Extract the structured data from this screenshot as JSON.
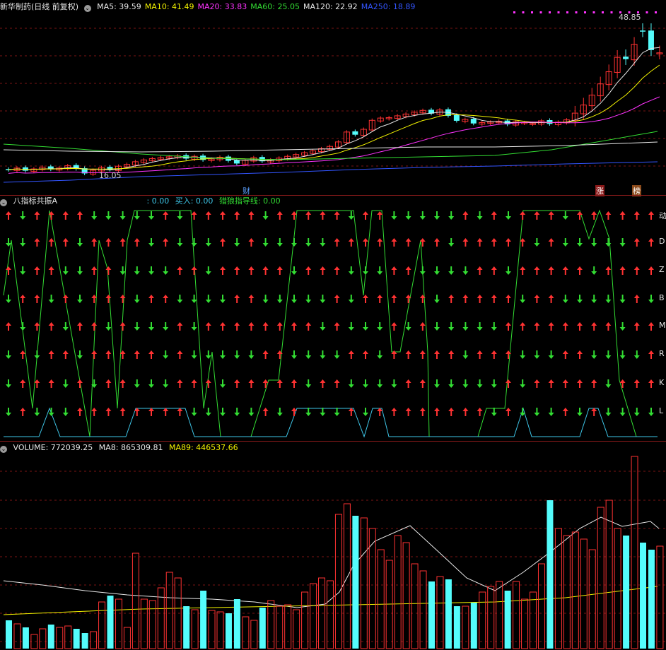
{
  "stock": {
    "name": "新华制药",
    "mode": "(日线 前复权)"
  },
  "ma": [
    {
      "label": "MA5: 39.59",
      "color": "#e8e8e8"
    },
    {
      "label": "MA10: 41.49",
      "color": "#f2f200"
    },
    {
      "label": "MA20: 33.83",
      "color": "#ff33ff"
    },
    {
      "label": "MA60: 25.05",
      "color": "#33dd33"
    },
    {
      "label": "MA120: 22.92",
      "color": "#e8e8e8"
    },
    {
      "label": "MA250: 18.89",
      "color": "#3355ff"
    }
  ],
  "price_marks": {
    "high": "48.85",
    "low": "16.05"
  },
  "event_tags": {
    "cai": "财",
    "zhang": "涨",
    "bang": "榜"
  },
  "indicator": {
    "name": "八指标共振A",
    "v1": ": 0.00",
    "buy": "买入: 0.00",
    "line": "猎狼指导线: 0.00",
    "rows": [
      "动",
      "D",
      "Z",
      "B",
      "M",
      "R",
      "K",
      "L"
    ]
  },
  "volume": {
    "label": "VOLUME: 772039.25",
    "ma8": "MA8: 865309.81",
    "ma89": "MA89: 446537.66"
  },
  "colors": {
    "up": "#ff3232",
    "down": "#54fcfc",
    "grid": "#7a1515",
    "green": "#33dd33",
    "cyan": "#3ec6e8"
  },
  "chart_data": [
    {
      "type": "candlestick",
      "title": "新华制药 (日线 前复权)",
      "x": [
        1,
        2,
        3,
        4,
        5,
        6,
        7,
        8,
        9,
        10,
        11,
        12,
        13,
        14,
        15,
        16,
        17,
        18,
        19,
        20,
        21,
        22,
        23,
        24,
        25,
        26,
        27,
        28,
        29,
        30,
        31,
        32,
        33,
        34,
        35,
        36,
        37,
        38,
        39,
        40,
        41,
        42,
        43,
        44,
        45,
        46,
        47,
        48,
        49,
        50,
        51,
        52,
        53,
        54,
        55,
        56,
        57,
        58,
        59,
        60,
        61,
        62,
        63,
        64,
        65,
        66,
        67,
        68,
        69,
        70,
        71,
        72,
        73,
        74,
        75,
        76,
        77,
        78
      ],
      "up": [
        0,
        1,
        0,
        1,
        1,
        0,
        1,
        1,
        0,
        0,
        1,
        1,
        0,
        1,
        1,
        1,
        1,
        1,
        1,
        1,
        1,
        0,
        1,
        0,
        1,
        1,
        0,
        0,
        1,
        1,
        0,
        1,
        1,
        1,
        1,
        1,
        1,
        1,
        1,
        1,
        1,
        0,
        1,
        1,
        1,
        1,
        1,
        1,
        1,
        1,
        0,
        1,
        0,
        0,
        1,
        0,
        1,
        1,
        1,
        0,
        1,
        1,
        1,
        1,
        0,
        1,
        1,
        1,
        1,
        1,
        1,
        1,
        1,
        0,
        1,
        0,
        0,
        1
      ],
      "close": [
        17.4,
        17.8,
        17.2,
        17.6,
        18.0,
        17.5,
        17.8,
        18.3,
        17.6,
        16.6,
        17.3,
        17.9,
        17.4,
        18.2,
        18.6,
        19.2,
        19.6,
        19.9,
        20.1,
        20.3,
        20.5,
        19.9,
        20.4,
        19.6,
        19.8,
        20.2,
        19.4,
        18.8,
        19.5,
        20.1,
        19.3,
        19.6,
        20.0,
        20.4,
        20.8,
        21.2,
        21.6,
        22.1,
        22.6,
        23.6,
        25.8,
        25.2,
        26.4,
        28.4,
        28.9,
        29.0,
        29.4,
        29.8,
        30.2,
        30.6,
        29.9,
        30.7,
        29.4,
        28.3,
        28.6,
        27.7,
        27.9,
        28.0,
        28.2,
        27.5,
        28.1,
        27.9,
        27.7,
        28.3,
        27.6,
        28.0,
        28.5,
        30.0,
        31.8,
        34.0,
        36.5,
        39.2,
        42.4,
        42.0,
        45.3,
        48.2,
        44.0,
        43.4
      ]
    },
    {
      "type": "line",
      "title": "八指标共振A",
      "series": [
        {
          "name": "猎狼指导线",
          "values": [
            0,
            0,
            0,
            0,
            0,
            0,
            0,
            0
          ]
        },
        {
          "name": "买入",
          "values": [
            0,
            0,
            0,
            0,
            0,
            0,
            0,
            0
          ]
        }
      ],
      "categories": [
        "动",
        "D",
        "Z",
        "B",
        "M",
        "R",
        "K",
        "L"
      ]
    },
    {
      "type": "bar",
      "title": "VOLUME",
      "series": [
        {
          "name": "VOLUME",
          "values": [
            772039.25
          ]
        },
        {
          "name": "MA8",
          "values": [
            865309.81
          ]
        },
        {
          "name": "MA89",
          "values": [
            446537.66
          ]
        }
      ]
    }
  ]
}
